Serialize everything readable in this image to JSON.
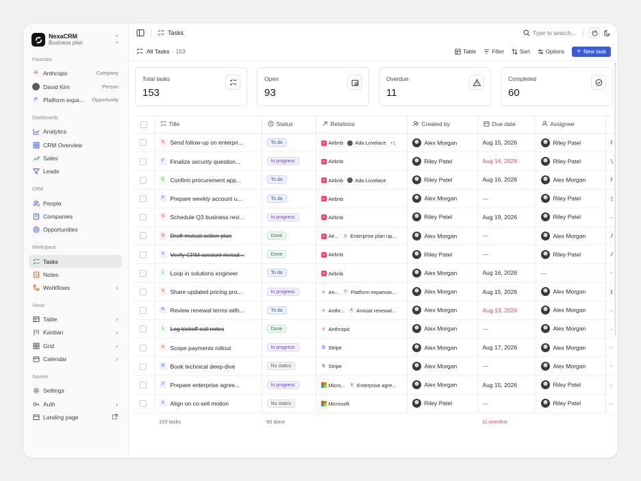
{
  "workspace": {
    "name": "NexaCRM",
    "plan": "Business plan"
  },
  "sidebar": {
    "favorites_title": "Favorites",
    "favorites": [
      {
        "label": "Anthropic",
        "tag": "Company",
        "icon": "anthropic-icon"
      },
      {
        "label": "David Kim",
        "tag": "Person",
        "icon": "avatar"
      },
      {
        "label": "Platform expa...",
        "tag": "Opportunity",
        "icon": "opportunity-icon"
      }
    ],
    "dashboards_title": "Dashboards",
    "dashboards": [
      {
        "label": "Analytics"
      },
      {
        "label": "CRM Overview"
      },
      {
        "label": "Sales"
      },
      {
        "label": "Leads"
      }
    ],
    "crm_title": "CRM",
    "crm": [
      {
        "label": "People"
      },
      {
        "label": "Companies"
      },
      {
        "label": "Opportunities"
      }
    ],
    "workspace_title": "Workspace",
    "workspace": [
      {
        "label": "Tasks"
      },
      {
        "label": "Notes"
      },
      {
        "label": "Workflows"
      }
    ],
    "views_title": "Views",
    "views": [
      {
        "label": "Table"
      },
      {
        "label": "Kanban"
      },
      {
        "label": "Grid"
      },
      {
        "label": "Calendar"
      }
    ],
    "system_title": "System",
    "system": [
      {
        "label": "Settings"
      },
      {
        "label": "Auth"
      },
      {
        "label": "Landing page"
      }
    ]
  },
  "topbar": {
    "title": "Tasks",
    "search_placeholder": "Type to search..."
  },
  "toolbar": {
    "view": "All Tasks",
    "count": "· 153",
    "table": "Table",
    "filter": "Filter",
    "sort": "Sort",
    "options": "Options",
    "new_task": "New task"
  },
  "stats": [
    {
      "label": "Total tasks",
      "value": "153"
    },
    {
      "label": "Open",
      "value": "93"
    },
    {
      "label": "Overdue",
      "value": "11"
    },
    {
      "label": "Completed",
      "value": "60"
    }
  ],
  "columns": [
    "Title",
    "Status",
    "Relations",
    "Created by",
    "Due date",
    "Assignee"
  ],
  "rows": [
    {
      "letter": "S",
      "title": "Send follow-up on enterpri...",
      "status": "To do",
      "rels": [
        [
          "airbnb",
          "Airbnb"
        ],
        [
          "person",
          "Ada Lovelace"
        ]
      ],
      "more": "+1",
      "created": "Alex Morgan",
      "due": "Aug 15, 2026",
      "assignee": "Riley Patel",
      "extra": "F"
    },
    {
      "letter": "F",
      "title": "Finalize security question...",
      "status": "In progress",
      "rels": [
        [
          "airbnb",
          "Airbnb"
        ]
      ],
      "created": "Riley Patel",
      "due": "Aug 14, 2026",
      "overdue": true,
      "assignee": "Riley Patel",
      "extra": "V"
    },
    {
      "letter": "C",
      "title": "Confirm procurement app...",
      "status": "To do",
      "rels": [
        [
          "airbnb",
          "Airbnb"
        ],
        [
          "person",
          "Ada Lovelace"
        ]
      ],
      "created": "Riley Patel",
      "due": "Aug 16, 2026",
      "assignee": "Alex Morgan",
      "extra": "N"
    },
    {
      "letter": "P",
      "title": "Prepare weekly account u...",
      "status": "To do",
      "rels": [
        [
          "airbnb",
          "Airbnb"
        ]
      ],
      "created": "Alex Morgan",
      "due": "—",
      "assignee": "Riley Patel",
      "extra": "S"
    },
    {
      "letter": "S",
      "title": "Schedule Q3 business revi...",
      "status": "In progress",
      "rels": [
        [
          "airbnb",
          "Airbnb"
        ]
      ],
      "created": "Riley Patel",
      "due": "Aug 19, 2026",
      "assignee": "Riley Patel",
      "extra": "-"
    },
    {
      "letter": "D",
      "title": "Draft mutual action plan",
      "strike": true,
      "status": "Done",
      "rels": [
        [
          "airbnb",
          "Air..."
        ],
        [
          "opp",
          "Enterprise plan up..."
        ]
      ],
      "created": "Alex Morgan",
      "due": "—",
      "assignee": "Alex Morgan",
      "extra": "A"
    },
    {
      "letter": "V",
      "title": "Verify CRM account metad...",
      "strike": true,
      "status": "Done",
      "rels": [
        [
          "airbnb",
          "Airbnb"
        ]
      ],
      "created": "Riley Patel",
      "due": "—",
      "assignee": "Riley Patel",
      "extra": "A"
    },
    {
      "letter": "L",
      "title": "Loop in solutions engineer",
      "status": "To do",
      "rels": [
        [
          "airbnb",
          "Airbnb"
        ]
      ],
      "created": "Alex Morgan",
      "due": "Aug 16, 2026",
      "assignee": "—",
      "extra": "-"
    },
    {
      "letter": "S",
      "title": "Share updated pricing pro...",
      "status": "In progress",
      "rels": [
        [
          "anth",
          "An..."
        ],
        [
          "opp",
          "Platform expansio..."
        ]
      ],
      "created": "Alex Morgan",
      "due": "Aug 15, 2026",
      "assignee": "Alex Morgan",
      "extra": "E"
    },
    {
      "letter": "R",
      "title": "Review renewal terms with...",
      "status": "To do",
      "rels": [
        [
          "anth",
          "Anthr..."
        ],
        [
          "opp",
          "Annual renewal..."
        ]
      ],
      "created": "Alex Morgan",
      "due": "Aug 13, 2026",
      "overdue": true,
      "assignee": "Alex Morgan",
      "extra": "-"
    },
    {
      "letter": "L",
      "title": "Log kickoff call notes",
      "strike": true,
      "status": "Done",
      "rels": [
        [
          "anth",
          "Anthropic"
        ]
      ],
      "created": "Alex Morgan",
      "due": "—",
      "assignee": "Alex Morgan",
      "extra": "-"
    },
    {
      "letter": "S",
      "title": "Scope payments rollout",
      "status": "In progress",
      "rels": [
        [
          "stripe",
          "Stripe"
        ]
      ],
      "created": "Alex Morgan",
      "due": "Aug 17, 2026",
      "assignee": "Alex Morgan",
      "extra": "-"
    },
    {
      "letter": "B",
      "title": "Book technical deep-dive",
      "status": "No status",
      "rels": [
        [
          "stripe",
          "Stripe"
        ]
      ],
      "created": "Alex Morgan",
      "due": "—",
      "assignee": "Alex Morgan",
      "extra": "-"
    },
    {
      "letter": "P",
      "title": "Prepare enterprise agree...",
      "status": "In progress",
      "rels": [
        [
          "ms",
          "Micro..."
        ],
        [
          "opp",
          "Enterprise agre..."
        ]
      ],
      "created": "Alex Morgan",
      "due": "Aug 15, 2026",
      "assignee": "Riley Patel",
      "extra": "-"
    },
    {
      "letter": "A",
      "title": "Align on co-sell motion",
      "status": "No status",
      "rels": [
        [
          "ms",
          "Microsoft"
        ]
      ],
      "created": "Riley Patel",
      "due": "—",
      "assignee": "Riley Patel",
      "extra": "-"
    }
  ],
  "footer": {
    "count": "153 tasks",
    "done": "60 done",
    "overdue": "11 overdue"
  },
  "colors": {
    "accent": "#3b5bdb",
    "overdue": "#e5484d",
    "brand": "#151517"
  }
}
